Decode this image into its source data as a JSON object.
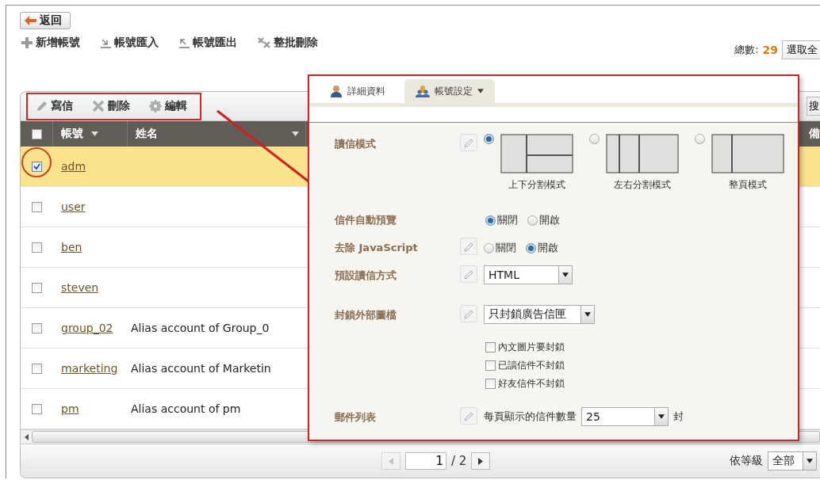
{
  "back_button": "返回",
  "actions": [
    {
      "label": "新增帳號",
      "kind": "add"
    },
    {
      "label": "帳號匯入",
      "kind": "import"
    },
    {
      "label": "帳號匯出",
      "kind": "export"
    },
    {
      "label": "整批刪除",
      "kind": "bulk_delete"
    }
  ],
  "total": {
    "label": "總數:",
    "count": "29"
  },
  "select_all_button": "選取全",
  "grid": {
    "toolbar": [
      {
        "label": "寫信",
        "kind": "write"
      },
      {
        "label": "刪除",
        "kind": "delete"
      },
      {
        "label": "編輯",
        "kind": "edit"
      }
    ],
    "search_button": "搜",
    "select_all_checked": false,
    "columns": [
      "帳號",
      "姓名"
    ],
    "column_3": "備",
    "rows": [
      {
        "account": "adm",
        "checked": true,
        "selected": true
      },
      {
        "account": "user",
        "checked": false,
        "selected": false
      },
      {
        "account": "ben",
        "checked": false,
        "selected": false
      },
      {
        "account": "steven",
        "checked": false,
        "selected": false
      },
      {
        "account": "group_02",
        "name": "Alias account of Group_0",
        "checked": false,
        "selected": false
      },
      {
        "account": "marketing",
        "name": "Alias account of Marketin",
        "checked": false,
        "selected": false
      },
      {
        "account": "pm",
        "name": "Alias account of pm",
        "checked": false,
        "selected": false
      }
    ],
    "pager": {
      "page": "1",
      "of": "/ 2"
    },
    "level_filter": {
      "label": "依等級",
      "value": "全部"
    }
  },
  "panel": {
    "tabs": [
      {
        "label": "詳細資料",
        "selected": false,
        "kind": "person"
      },
      {
        "label": "帳號設定",
        "selected": true,
        "kind": "group"
      }
    ],
    "settings": [
      {
        "label": "讀信模式",
        "kind": "layout",
        "editable": true,
        "options": [
          {
            "label": "上下分割模式",
            "kind": "split",
            "selected": true
          },
          {
            "label": "左右分割模式",
            "kind": "three",
            "selected": false
          },
          {
            "label": "整頁模式",
            "kind": "two",
            "selected": false
          }
        ]
      },
      {
        "label": "信件自動預覽",
        "kind": "radio",
        "editable": false,
        "options": [
          {
            "label": "關閉",
            "selected": true
          },
          {
            "label": "開啟",
            "selected": false
          }
        ]
      },
      {
        "label": "去除 JavaScript",
        "kind": "radio",
        "editable": true,
        "options": [
          {
            "label": "關閉",
            "selected": false
          },
          {
            "label": "開啟",
            "selected": true
          }
        ]
      },
      {
        "label": "預設讀信方式",
        "kind": "select",
        "editable": true,
        "value": "HTML"
      },
      {
        "label": "封鎖外部圖檔",
        "kind": "select",
        "editable": true,
        "value": "只封鎖廣告信匣",
        "checkboxes": [
          {
            "label": "內文圖片要封鎖",
            "checked": false
          },
          {
            "label": "已讀信件不封鎖",
            "checked": false
          },
          {
            "label": "好友信件不封鎖",
            "checked": false
          }
        ]
      },
      {
        "label": "郵件列表",
        "kind": "count",
        "editable": true,
        "prefix": "每頁顯示的信件數量",
        "value": "25",
        "suffix": "封"
      }
    ]
  }
}
